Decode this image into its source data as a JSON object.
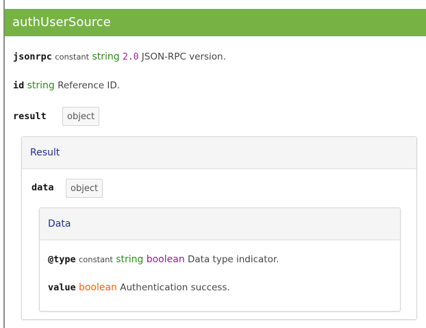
{
  "header": {
    "title": "authUserSource"
  },
  "fields": {
    "jsonrpc": {
      "name": "jsonrpc",
      "qualifier": "constant",
      "type": "string",
      "value": "2.0",
      "description": "JSON-RPC version."
    },
    "id": {
      "name": "id",
      "type": "string",
      "description": "Reference ID."
    },
    "result": {
      "name": "result",
      "type_badge": "object"
    }
  },
  "result_panel": {
    "title": "Result",
    "data": {
      "name": "data",
      "type_badge": "object"
    },
    "data_panel": {
      "title": "Data",
      "type_field": {
        "name": "@type",
        "qualifier": "constant",
        "type": "string",
        "value": "boolean",
        "description": "Data type indicator."
      },
      "value_field": {
        "name": "value",
        "type": "boolean",
        "description": "Authentication success."
      }
    }
  },
  "colors": {
    "header_bg": "#76b244",
    "string_type": "#2e8b17",
    "const_value": "#9c1f9c",
    "boolean_type": "#ff5b1a",
    "panel_title": "#1e2f8a"
  }
}
